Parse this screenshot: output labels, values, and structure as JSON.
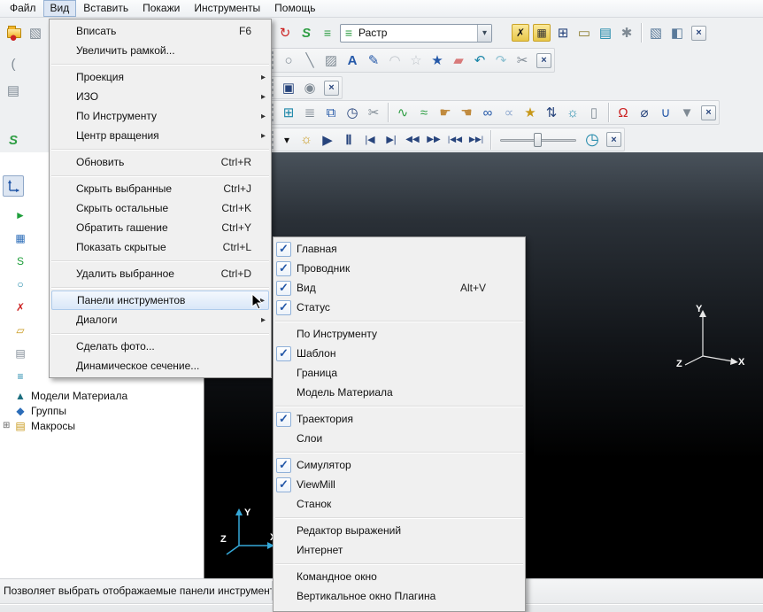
{
  "menubar": {
    "items": [
      {
        "label": "Файл",
        "n": "menubar-item-file"
      },
      {
        "label": "Вид",
        "c": "active",
        "n": "menubar-item-view"
      },
      {
        "label": "Вставить",
        "n": "menubar-item-insert"
      },
      {
        "label": "Покажи",
        "n": "menubar-item-display"
      },
      {
        "label": "Инструменты",
        "n": "menubar-item-tools"
      },
      {
        "label": "Помощь",
        "n": "menubar-item-help"
      }
    ]
  },
  "view_menu": {
    "items": [
      {
        "label": "Вписать",
        "shortcut": "F6",
        "n": "menu-item-fit"
      },
      {
        "label": "Увеличить рамкой...",
        "n": "menu-item-zoom-box"
      },
      {
        "sep": true
      },
      {
        "label": "Проекция",
        "submenu": true,
        "n": "menu-item-projection"
      },
      {
        "label": "ИЗО",
        "submenu": true,
        "n": "menu-item-iso"
      },
      {
        "label": "По Инструменту",
        "submenu": true,
        "n": "menu-item-from-tool"
      },
      {
        "label": "Центр вращения",
        "submenu": true,
        "n": "menu-item-rotation-center"
      },
      {
        "sep": true
      },
      {
        "label": "Обновить",
        "shortcut": "Ctrl+R",
        "n": "menu-item-refresh"
      },
      {
        "sep": true
      },
      {
        "label": "Скрыть выбранные",
        "shortcut": "Ctrl+J",
        "n": "menu-item-hide-selected"
      },
      {
        "label": "Скрыть остальные",
        "shortcut": "Ctrl+K",
        "n": "menu-item-hide-others"
      },
      {
        "label": "Обратить гашение",
        "shortcut": "Ctrl+Y",
        "n": "menu-item-invert-hidden"
      },
      {
        "label": "Показать скрытые",
        "shortcut": "Ctrl+L",
        "n": "menu-item-show-hidden"
      },
      {
        "sep": true
      },
      {
        "label": "Удалить выбранное",
        "shortcut": "Ctrl+D",
        "n": "menu-item-delete-selected"
      },
      {
        "sep": true
      },
      {
        "label": "Панели инструментов",
        "submenu": true,
        "c": "hl",
        "n": "menu-item-toolbars"
      },
      {
        "label": "Диалоги",
        "submenu": true,
        "n": "menu-item-dialogs"
      },
      {
        "sep": true
      },
      {
        "label": "Сделать фото...",
        "n": "menu-item-snapshot"
      },
      {
        "label": "Динамическое сечение...",
        "n": "menu-item-dynamic-section"
      }
    ]
  },
  "toolbars_submenu": {
    "items": [
      {
        "label": "Главная",
        "checked": true,
        "n": "submenu-item-main"
      },
      {
        "label": "Проводник",
        "checked": true,
        "n": "submenu-item-explorer"
      },
      {
        "label": "Вид",
        "checked": true,
        "shortcut": "Alt+V",
        "n": "submenu-item-view"
      },
      {
        "label": "Статус",
        "checked": true,
        "n": "submenu-item-status"
      },
      {
        "sep": true
      },
      {
        "label": "По Инструменту",
        "n": "submenu-item-from-tool"
      },
      {
        "label": "Шаблон",
        "checked": true,
        "n": "submenu-item-pattern"
      },
      {
        "label": "Граница",
        "n": "submenu-item-boundary"
      },
      {
        "label": "Модель Материала",
        "n": "submenu-item-stock-model"
      },
      {
        "sep": true
      },
      {
        "label": "Траектория",
        "checked": true,
        "n": "submenu-item-toolpath"
      },
      {
        "label": "Слои",
        "n": "submenu-item-layers"
      },
      {
        "sep": true
      },
      {
        "label": "Симулятор",
        "checked": true,
        "n": "submenu-item-simulator"
      },
      {
        "label": "ViewMill",
        "checked": true,
        "n": "submenu-item-viewmill"
      },
      {
        "label": "Станок",
        "n": "submenu-item-machine"
      },
      {
        "sep": true
      },
      {
        "label": "Редактор выражений",
        "n": "submenu-item-expression-editor"
      },
      {
        "label": "Интернет",
        "n": "submenu-item-internet"
      },
      {
        "sep": true
      },
      {
        "label": "Командное окно",
        "n": "submenu-item-command-window"
      },
      {
        "label": "Вертикальное окно Плагина",
        "n": "submenu-item-plugin-window"
      }
    ]
  },
  "raster_combo": {
    "value": "Растр"
  },
  "explorer": {
    "items": [
      {
        "icon": "►",
        "c": "ic-green row-lg",
        "n": "tree-item"
      },
      {
        "icon": "▦",
        "c": "ic-blue row-lg",
        "n": "tree-item"
      },
      {
        "icon": "S",
        "c": "ic-green row-lg",
        "n": "tree-item"
      },
      {
        "icon": "○",
        "c": "ic-teal row-lg",
        "n": "tree-item"
      },
      {
        "icon": "✗",
        "c": "ic-red row-lg",
        "n": "tree-item"
      },
      {
        "icon": "▱",
        "c": "ic-gold row-lg",
        "n": "tree-item"
      },
      {
        "icon": "▤",
        "c": "ic-gray row-lg",
        "n": "tree-item"
      },
      {
        "icon": "≡",
        "c": "ic-teal row-lg",
        "n": "tree-item"
      },
      {
        "label": "Модели Материала",
        "icon": "▲",
        "c": "ic-dark row-sm",
        "n": "tree-item-stock-models"
      },
      {
        "label": "Группы",
        "icon": "◆",
        "c": "ic-blue row-sm",
        "n": "tree-item-groups"
      },
      {
        "label": "Макросы",
        "icon": "▤",
        "c": "ic-gold row-sm",
        "exp": true,
        "n": "tree-item-macros"
      }
    ]
  },
  "viewport": {
    "axes": {
      "x": "X",
      "y": "Y",
      "z": "Z"
    }
  },
  "statusbar": {
    "text": "Позволяет выбрать отображаемые панели инструментов"
  },
  "icons": {
    "submenu_arrow": "▸",
    "check": "✓",
    "expander": "⊞",
    "close": "×",
    "dropdown": "▾",
    "import": "▧",
    "refresh_view": "↻",
    "iso": "S",
    "shade": "≡",
    "toolpath_x": "✗",
    "pattern": "▦",
    "calculator": "⊞",
    "measure": "▭",
    "grid": "▤",
    "tools": "✱",
    "block": "▧",
    "block_alt": "◧",
    "ellipse": "○",
    "line": "╲",
    "surface": "▨",
    "curve_a": "A",
    "pen": "✎",
    "arc": "◠",
    "star_dim": "☆",
    "star": "★",
    "eraser": "▰",
    "undo": "↶",
    "redo": "↷",
    "scissors": "✂",
    "save": "▣",
    "record": "◉",
    "table": "⊞",
    "list": "≣",
    "copy": "⧉",
    "clock": "◷",
    "wave": "∿",
    "approx": "≈",
    "hand_r": "☛",
    "hand_l": "☚",
    "links": "∞",
    "links_alt": "∝",
    "sort": "⇅",
    "lamp": "☼",
    "trash": "▯",
    "magnet": "Ω",
    "diameter": "⌀",
    "holder": "∪",
    "stamp": "▼",
    "play": "▶",
    "pause": "Ⅱ",
    "step_back": "|◀",
    "step_fwd": "▶|",
    "rewind": "◀◀",
    "fast_fwd": "▶▶",
    "go_start": "|◀◀",
    "go_end": "▶▶|",
    "sphere": "●",
    "brace": "(",
    "palette": "▤",
    "iso2": "S"
  }
}
